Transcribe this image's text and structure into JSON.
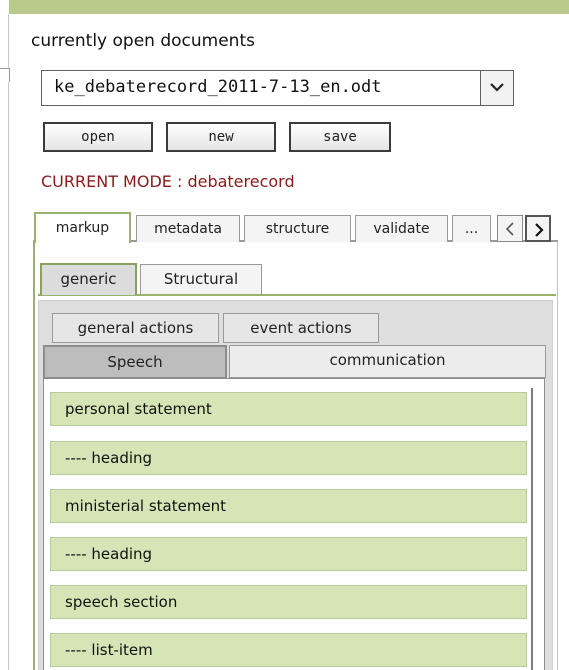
{
  "section_label": "currently open documents",
  "document_select": {
    "value": "ke_debaterecord_2011-7-13_en.odt"
  },
  "file_buttons": {
    "open": "open",
    "new": "new",
    "save": "save"
  },
  "mode": "CURRENT MODE : debaterecord",
  "main_tabs": [
    "markup",
    "metadata",
    "structure",
    "validate",
    "..."
  ],
  "main_tabs_active": "markup",
  "sub_tabs": [
    "generic",
    "Structural"
  ],
  "sub_tabs_active": "generic",
  "action_tabs_row1": [
    "general actions",
    "event actions"
  ],
  "action_tabs_row2": [
    "Speech",
    "communication"
  ],
  "action_tabs_active": "Speech",
  "actions": [
    "personal statement",
    "---- heading",
    "ministerial statement",
    "---- heading",
    "speech section",
    "---- list-item"
  ],
  "colors": {
    "accent_green": "#9ab26a",
    "item_green": "#d5e5b5",
    "mode_red": "#8b1a1a",
    "top_strip": "#b8c98a"
  }
}
